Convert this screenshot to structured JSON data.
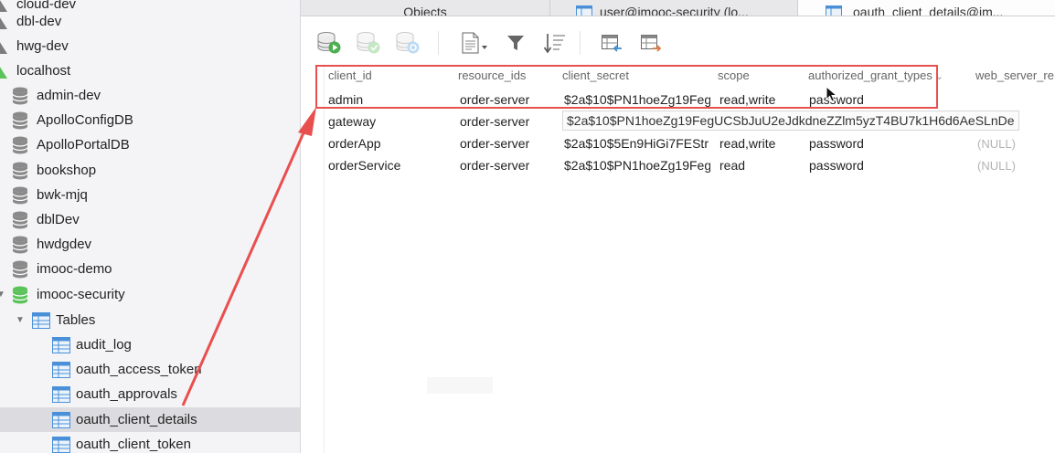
{
  "sidebar": {
    "connections": [
      {
        "label": "cloud-dev"
      },
      {
        "label": "dbl-dev"
      },
      {
        "label": "hwg-dev"
      },
      {
        "label": "localhost"
      }
    ],
    "databases": [
      {
        "label": "admin-dev"
      },
      {
        "label": "ApolloConfigDB"
      },
      {
        "label": "ApolloPortalDB"
      },
      {
        "label": "bookshop"
      },
      {
        "label": "bwk-mjq"
      },
      {
        "label": "dblDev"
      },
      {
        "label": "hwdgdev"
      },
      {
        "label": "imooc-demo"
      },
      {
        "label": "imooc-security"
      }
    ],
    "tables_label": "Tables",
    "tables": [
      {
        "label": "audit_log"
      },
      {
        "label": "oauth_access_token"
      },
      {
        "label": "oauth_approvals"
      },
      {
        "label": "oauth_client_details"
      },
      {
        "label": "oauth_client_token"
      }
    ],
    "selected_table": "oauth_client_details"
  },
  "tabs": [
    {
      "label": "Objects",
      "icon": "none"
    },
    {
      "label": "user@imooc-security (lo...",
      "icon": "table-icon"
    },
    {
      "label": "oauth_client_details@im...",
      "icon": "table-icon"
    }
  ],
  "toolbar": {
    "buttons": [
      {
        "name": "begin-transaction-button",
        "icon": "db-play-icon"
      },
      {
        "name": "commit-button",
        "icon": "db-check-icon"
      },
      {
        "name": "rollback-button",
        "icon": "db-undo-icon"
      },
      {
        "name": "text-view-button",
        "icon": "document-icon"
      },
      {
        "name": "filter-button",
        "icon": "funnel-icon"
      },
      {
        "name": "sort-button",
        "icon": "sort-icon"
      },
      {
        "name": "import-button",
        "icon": "import-icon"
      },
      {
        "name": "export-button",
        "icon": "export-icon"
      }
    ]
  },
  "grid": {
    "columns": [
      "client_id",
      "resource_ids",
      "client_secret",
      "scope",
      "authorized_grant_types",
      "web_server_re"
    ],
    "sorted_column_indicator": "⌄",
    "rows": [
      {
        "client_id": "admin",
        "resource_ids": "order-server",
        "client_secret": "$2a$10$PN1hoeZg19Feg",
        "scope": "read,write",
        "authorized_grant_types": "password",
        "web_server": ""
      },
      {
        "client_id": "gateway",
        "resource_ids": "order-server",
        "client_secret": "",
        "scope": "",
        "authorized_grant_types": "",
        "web_server": ""
      },
      {
        "client_id": "orderApp",
        "resource_ids": "order-server",
        "client_secret": "$2a$10$5En9HiGi7FEStr",
        "scope": "read,write",
        "authorized_grant_types": "password",
        "web_server": "(NULL)"
      },
      {
        "client_id": "orderService",
        "resource_ids": "order-server",
        "client_secret": "$2a$10$PN1hoeZg19Feg",
        "scope": "read",
        "authorized_grant_types": "password",
        "web_server": "(NULL)"
      }
    ],
    "tooltip": "$2a$10$PN1hoeZg19FegUCSbJuU2eJdkdneZZlm5yzT4BU7k1H6d6AeSLnDe"
  },
  "colors": {
    "annotation_red": "#e8504f",
    "db_active_green": "#5cc35a",
    "toolbar_green": "#4caf50",
    "toolbar_blue": "#3a8fd8"
  }
}
